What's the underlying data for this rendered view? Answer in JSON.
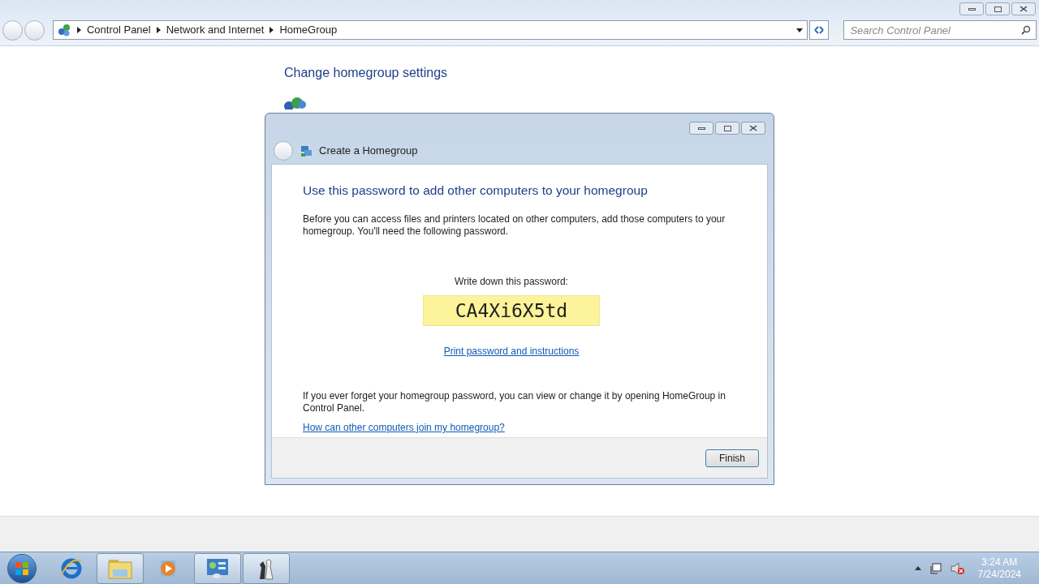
{
  "address_bar": {
    "crumbs": [
      "Control Panel",
      "Network and Internet",
      "HomeGroup"
    ]
  },
  "search": {
    "placeholder": "Search Control Panel"
  },
  "page": {
    "heading": "Change homegroup settings"
  },
  "dialog": {
    "title": "Create a Homegroup",
    "heading": "Use this password to add other computers to your homegroup",
    "intro": "Before you can access files and printers located on other computers, add those computers to your homegroup. You'll need the following password.",
    "password_label": "Write down this password:",
    "password": "CA4Xi6X5td",
    "print_link": "Print password and instructions",
    "note": "If you ever forget your homegroup password, you can view or change it by opening HomeGroup in Control Panel.",
    "help_link": "How can other computers join my homegroup?",
    "finish": "Finish"
  },
  "taskbar": {
    "items": [
      {
        "kind": "ie",
        "running": false
      },
      {
        "kind": "explorer",
        "running": true
      },
      {
        "kind": "media",
        "running": false
      },
      {
        "kind": "control",
        "running": true
      },
      {
        "kind": "chess",
        "running": true
      }
    ],
    "time": "3:24 AM",
    "date": "7/24/2024"
  }
}
